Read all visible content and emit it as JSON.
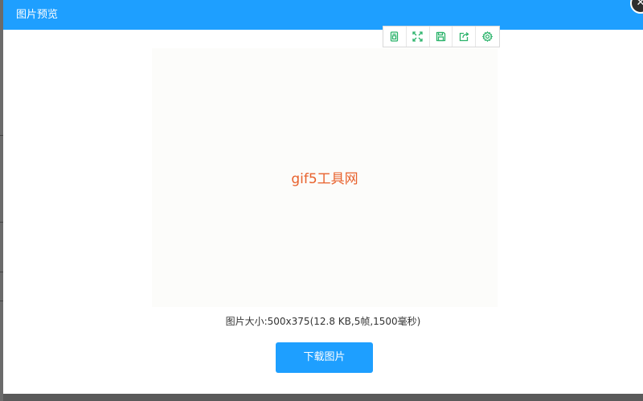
{
  "window": {
    "title": "图片预览",
    "close_icon": "close-icon",
    "header_color": "#1e9fff"
  },
  "toolbar": {
    "icon_color": "#2bb36b",
    "items": [
      {
        "name": "page-icon"
      },
      {
        "name": "fullscreen-icon"
      },
      {
        "name": "save-icon"
      },
      {
        "name": "share-icon"
      },
      {
        "name": "settings-icon"
      }
    ]
  },
  "preview": {
    "text": "gif5工具网",
    "text_color": "#e8612c"
  },
  "info": {
    "text": "图片大小:500x375(12.8 KB,5帧,1500毫秒)"
  },
  "actions": {
    "download_label": "下载图片",
    "button_color": "#1e9fff"
  }
}
